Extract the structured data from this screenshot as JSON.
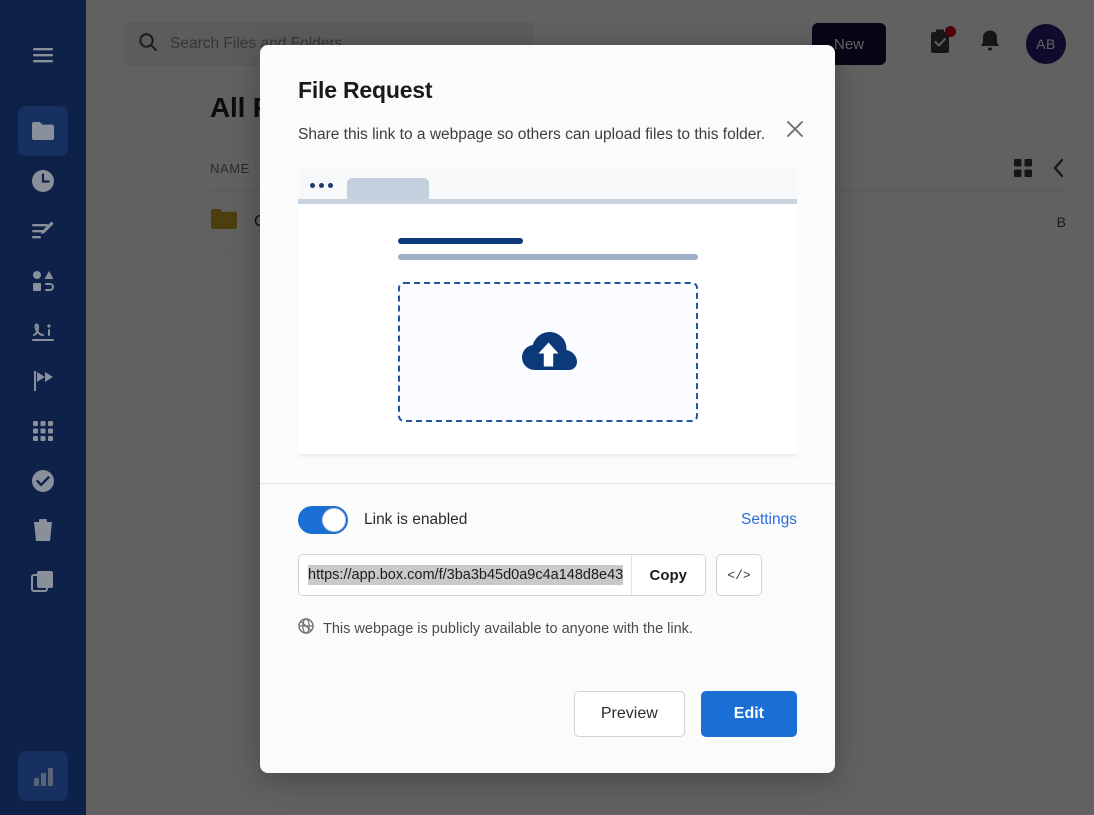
{
  "sidebar": {
    "items": [
      {
        "name": "menu-toggle",
        "icon": "hamburger-icon",
        "active": false
      },
      {
        "name": "files",
        "icon": "folder-icon",
        "active": true
      },
      {
        "name": "recents",
        "icon": "clock-icon",
        "active": false
      },
      {
        "name": "notes",
        "icon": "note-edit-icon",
        "active": false
      },
      {
        "name": "canvas",
        "icon": "shapes-icon",
        "active": false
      },
      {
        "name": "sign",
        "icon": "signature-icon",
        "active": false
      },
      {
        "name": "relay",
        "icon": "relay-flags-icon",
        "active": false
      },
      {
        "name": "apps",
        "icon": "grid-apps-icon",
        "active": false
      },
      {
        "name": "tasks",
        "icon": "check-circle-icon",
        "active": false
      },
      {
        "name": "trash",
        "icon": "trash-icon",
        "active": false
      },
      {
        "name": "copies",
        "icon": "stack-icon",
        "active": false
      }
    ],
    "bottom_item": {
      "name": "insights",
      "icon": "bar-chart-icon"
    }
  },
  "topbar": {
    "search_placeholder": "Search Files and Folders",
    "new_button_label": "New",
    "icons": [
      {
        "name": "clipboard-check-icon",
        "badge": true
      },
      {
        "name": "bell-icon",
        "badge": false
      }
    ],
    "avatar_initials": "AB"
  },
  "page": {
    "title": "All Files",
    "column_header_name": "NAME",
    "rows": [
      {
        "name": "Client Files",
        "size": "B"
      }
    ],
    "view_icons": [
      "grid-view-icon",
      "chevron-left-icon"
    ]
  },
  "modal": {
    "title": "File Request",
    "description": "Share this link to a webpage so others can upload files to this folder.",
    "close_label": "×",
    "link_toggle": {
      "label": "Link is enabled",
      "enabled": true,
      "on_color": "#1a6fd4"
    },
    "settings_label": "Settings",
    "url": "https://app.box.com/f/3ba3b45d0a9c4a148d8e43",
    "url_selected": true,
    "copy_label": "Copy",
    "embed_label": "</>",
    "visibility_note": "This webpage is publicly available to anyone with the link.",
    "visibility_icon": "globe-icon",
    "buttons": {
      "preview_label": "Preview",
      "edit_label": "Edit",
      "primary_color": "#1a6fd4"
    },
    "preview": {
      "icon": "cloud-upload-icon",
      "accent_color": "#0c3a78",
      "dropzone_border_color": "#2456a0"
    }
  }
}
